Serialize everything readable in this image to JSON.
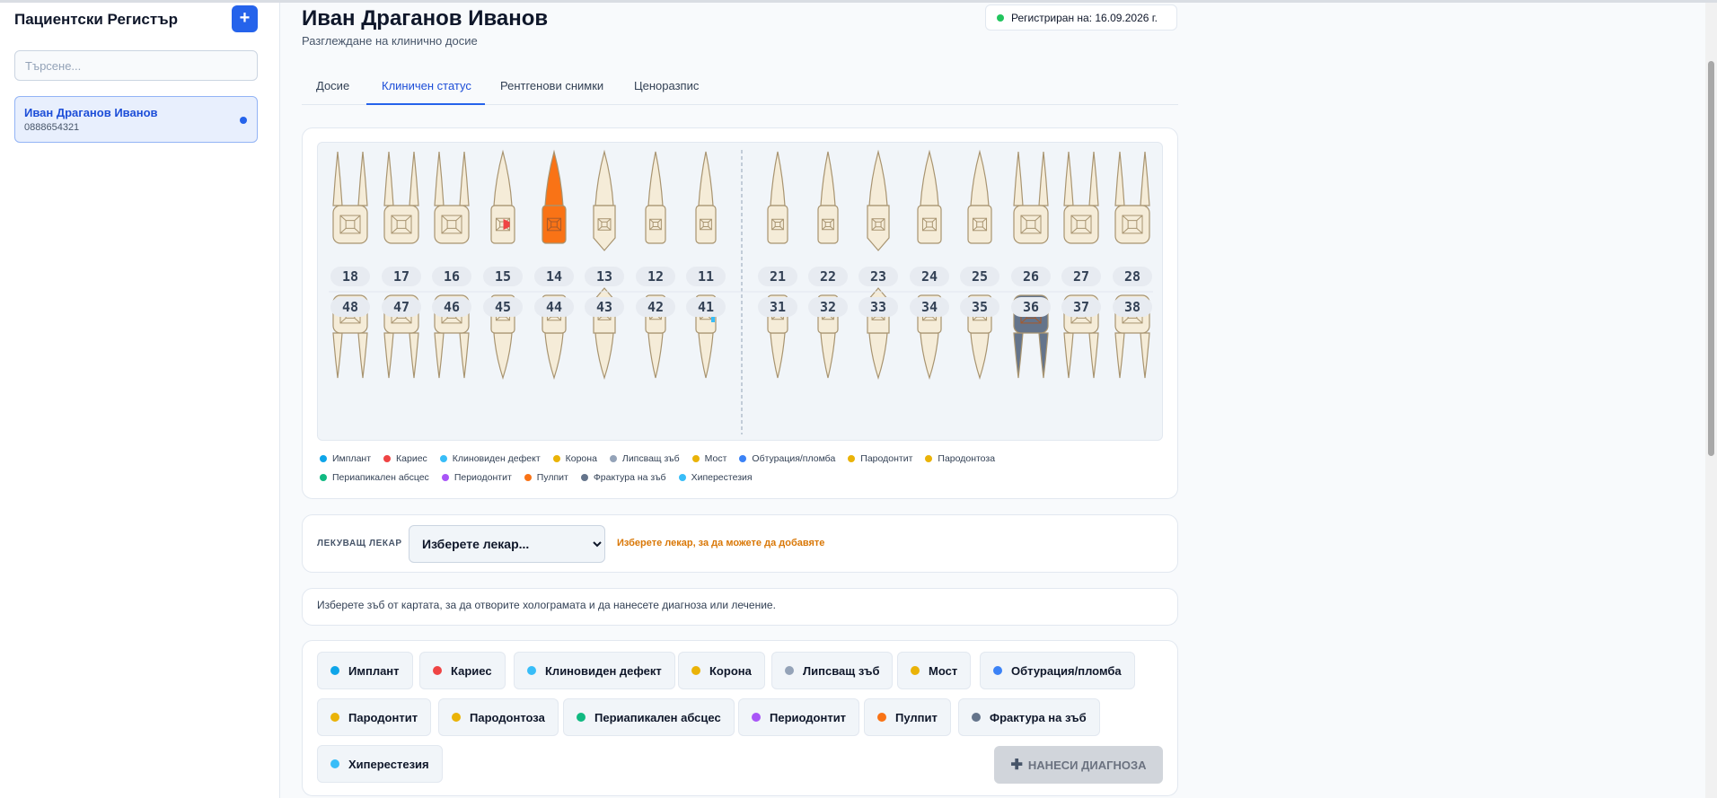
{
  "app": {
    "title": "Пациентски Регистър",
    "add_label": "+",
    "search_placeholder": "Търсене..."
  },
  "patients": [
    {
      "name": "Иван Драганов Иванов",
      "phone": "0888654321"
    }
  ],
  "header": {
    "name": "Иван Драганов Иванов",
    "subtitle": "Разглеждане на клинично досие",
    "registered": "Регистриран на: 16.09.2026 г."
  },
  "tabs": [
    "Досие",
    "Клиничен статус",
    "Рентгенови снимки",
    "Ценоразпис"
  ],
  "active_tab": "Клиничен статус",
  "chart": {
    "upper": [
      "18",
      "17",
      "16",
      "15",
      "14",
      "13",
      "12",
      "11",
      "21",
      "22",
      "23",
      "24",
      "25",
      "26",
      "27",
      "28"
    ],
    "lower": [
      "48",
      "47",
      "46",
      "45",
      "44",
      "43",
      "42",
      "41",
      "31",
      "32",
      "33",
      "34",
      "35",
      "36",
      "37",
      "38"
    ],
    "marked": [
      {
        "tooth": "15",
        "condition": "Кариес",
        "color": "#ef4444"
      },
      {
        "tooth": "14",
        "condition": "Пулпит",
        "color": "#f97316"
      },
      {
        "tooth": "41",
        "condition": "Хиперестезия",
        "color": "#38bdf8"
      },
      {
        "tooth": "36",
        "condition": "Фрактура на зъб",
        "color": "#64748b"
      }
    ]
  },
  "conditions": [
    {
      "label": "Имплант",
      "color": "#0ea5e9"
    },
    {
      "label": "Кариес",
      "color": "#ef4444"
    },
    {
      "label": "Клиновиден дефект",
      "color": "#38bdf8"
    },
    {
      "label": "Корона",
      "color": "#eab308"
    },
    {
      "label": "Липсващ зъб",
      "color": "#94a3b8"
    },
    {
      "label": "Мост",
      "color": "#eab308"
    },
    {
      "label": "Обтурация/пломба",
      "color": "#3b82f6"
    },
    {
      "label": "Пародонтит",
      "color": "#eab308"
    },
    {
      "label": "Пародонтоза",
      "color": "#eab308"
    },
    {
      "label": "Периапикален абсцес",
      "color": "#10b981"
    },
    {
      "label": "Периодонтит",
      "color": "#a855f7"
    },
    {
      "label": "Пулпит",
      "color": "#f97316"
    },
    {
      "label": "Фрактура на зъб",
      "color": "#64748b"
    },
    {
      "label": "Хиперестезия",
      "color": "#38bdf8"
    }
  ],
  "doctor": {
    "label": "ЛЕКУВАЩ ЛЕКАР",
    "select_value": "Изберете лекар...",
    "warning": "Изберете лекар, за да можете да добавяте"
  },
  "hint": "Изберете зъб от картата, за да отворите холограмата и да нанесете диагноза или лечение.",
  "apply_label": "НАНЕСИ ДИАГНОЗА"
}
